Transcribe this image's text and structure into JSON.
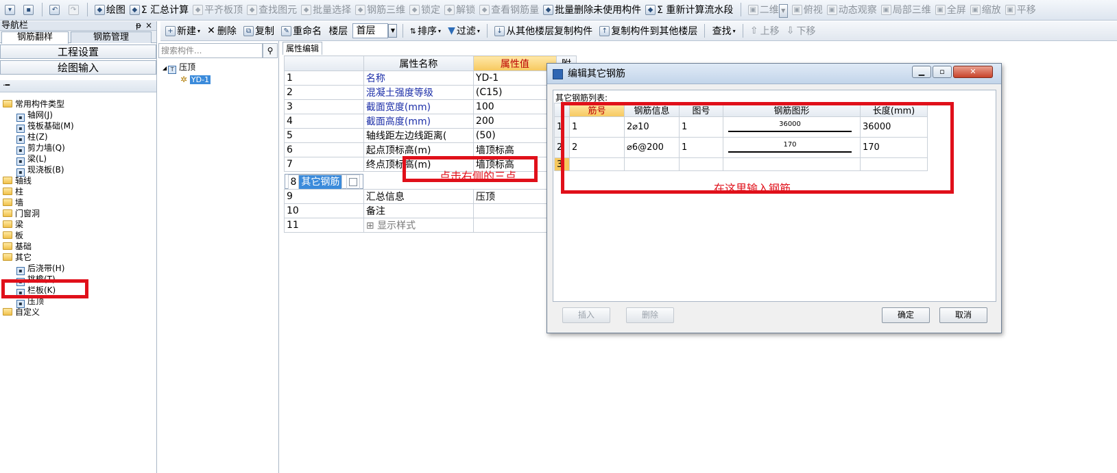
{
  "toolbar": {
    "items": [
      {
        "label": "绘图",
        "icon": "draw-icon",
        "disabled": false
      },
      {
        "label": "Σ 汇总计算",
        "icon": "sum-icon",
        "disabled": false
      },
      {
        "label": "平齐板顶",
        "icon": "align-icon",
        "disabled": true
      },
      {
        "label": "查找图元",
        "icon": "find-icon",
        "disabled": true
      },
      {
        "label": "批量选择",
        "icon": "batch-select-icon",
        "disabled": true
      },
      {
        "label": "钢筋三维",
        "icon": "rebar-3d-icon",
        "disabled": true
      },
      {
        "label": "锁定",
        "icon": "lock-icon",
        "disabled": true
      },
      {
        "label": "解锁",
        "icon": "unlock-icon",
        "disabled": true
      },
      {
        "label": "查看钢筋量",
        "icon": "view-icon",
        "disabled": true
      },
      {
        "label": "批量删除未使用构件",
        "icon": "batch-delete-icon",
        "disabled": false
      },
      {
        "label": "Σ 重新计算流水段",
        "icon": "recalc-icon",
        "disabled": false
      }
    ],
    "view_items": [
      {
        "label": "二维",
        "disabled": true
      },
      {
        "label": "俯视",
        "disabled": true
      },
      {
        "label": "动态观察",
        "disabled": true
      },
      {
        "label": "局部三维",
        "disabled": true
      },
      {
        "label": "全屏",
        "disabled": true
      },
      {
        "label": "缩放",
        "disabled": true
      },
      {
        "label": "平移",
        "disabled": true
      }
    ]
  },
  "subtoolbar": {
    "new": "新建",
    "delete": "删除",
    "copy": "复制",
    "rename": "重命名",
    "floor_label": "楼层",
    "floor_value": "首层",
    "sort": "排序",
    "filter": "过滤",
    "copy_from": "从其他楼层复制构件",
    "copy_to": "复制构件到其他楼层",
    "find": "查找",
    "move_up": "上移",
    "move_down": "下移"
  },
  "nav": {
    "title": "导航栏",
    "pin": "ᵽ",
    "close": "×",
    "tabs": [
      "钢筋翻样",
      "钢筋管理"
    ],
    "buttons": [
      "工程设置",
      "绘图输入"
    ],
    "tree": [
      {
        "label": "常用构件类型",
        "level": 0,
        "type": "folder"
      },
      {
        "label": "轴网(J)",
        "level": 1,
        "type": "item",
        "icon": "grid-icon"
      },
      {
        "label": "筏板基础(M)",
        "level": 1,
        "type": "item",
        "icon": "raft-icon"
      },
      {
        "label": "柱(Z)",
        "level": 1,
        "type": "item",
        "icon": "column-icon"
      },
      {
        "label": "剪力墙(Q)",
        "level": 1,
        "type": "item",
        "icon": "wall-icon"
      },
      {
        "label": "梁(L)",
        "level": 1,
        "type": "item",
        "icon": "beam-icon"
      },
      {
        "label": "现浇板(B)",
        "level": 1,
        "type": "item",
        "icon": "slab-icon"
      },
      {
        "label": "轴线",
        "level": 0,
        "type": "folder"
      },
      {
        "label": "柱",
        "level": 0,
        "type": "folder"
      },
      {
        "label": "墙",
        "level": 0,
        "type": "folder"
      },
      {
        "label": "门窗洞",
        "level": 0,
        "type": "folder"
      },
      {
        "label": "梁",
        "level": 0,
        "type": "folder"
      },
      {
        "label": "板",
        "level": 0,
        "type": "folder"
      },
      {
        "label": "基础",
        "level": 0,
        "type": "folder"
      },
      {
        "label": "其它",
        "level": 0,
        "type": "folder"
      },
      {
        "label": "后浇带(H)",
        "level": 1,
        "type": "item",
        "icon": "post-cast-icon"
      },
      {
        "label": "挑檐(T)",
        "level": 1,
        "type": "item",
        "icon": "eave-icon"
      },
      {
        "label": "栏板(K)",
        "level": 1,
        "type": "item",
        "icon": "parapet-icon"
      },
      {
        "label": "压顶",
        "level": 1,
        "type": "item",
        "icon": "coping-icon"
      },
      {
        "label": "自定义",
        "level": 0,
        "type": "folder"
      }
    ]
  },
  "component_list": {
    "search_placeholder": "搜索构件...",
    "root": "压顶",
    "child": "YD-1"
  },
  "properties": {
    "tab_label": "属性编辑",
    "headers": [
      "属性名称",
      "属性值",
      "附"
    ],
    "rows": [
      {
        "n": "1",
        "name": "名称",
        "value": "YD-1",
        "style": "blue",
        "check": false
      },
      {
        "n": "2",
        "name": "混凝土强度等级",
        "value": "(C15)",
        "style": "blue",
        "check": true
      },
      {
        "n": "3",
        "name": "截面宽度(mm)",
        "value": "100",
        "style": "blue",
        "check": true
      },
      {
        "n": "4",
        "name": "截面高度(mm)",
        "value": "200",
        "style": "blue",
        "check": true
      },
      {
        "n": "5",
        "name": "轴线距左边线距离(",
        "value": "(50)",
        "style": "normal",
        "check": true
      },
      {
        "n": "6",
        "name": "起点顶标高(m)",
        "value": "墙顶标高",
        "style": "normal",
        "check": true
      },
      {
        "n": "7",
        "name": "终点顶标高(m)",
        "value": "墙顶标高",
        "style": "normal",
        "check": true
      },
      {
        "n": "8",
        "name": "其它钢筋",
        "value": "",
        "style": "selected",
        "check": true
      },
      {
        "n": "9",
        "name": "汇总信息",
        "value": "压顶",
        "style": "normal",
        "check": true
      },
      {
        "n": "10",
        "name": "备注",
        "value": "",
        "style": "normal",
        "check": true
      },
      {
        "n": "11",
        "name": "显示样式",
        "value": "",
        "style": "gray",
        "check": false
      }
    ]
  },
  "annotations": {
    "click_hint": "点击右侧的三点",
    "input_hint": "在这里输入钢筋"
  },
  "dialog": {
    "title": "编辑其它钢筋",
    "list_label": "其它钢筋列表:",
    "headers": [
      "筋号",
      "钢筋信息",
      "图号",
      "钢筋图形",
      "长度(mm)"
    ],
    "rows": [
      {
        "rn": "1",
        "no": "1",
        "info": "2⌀10",
        "fig": "1",
        "shape": "36000",
        "length": "36000"
      },
      {
        "rn": "2",
        "no": "2",
        "info": "⌀6@200",
        "fig": "1",
        "shape": "170",
        "length": "170"
      },
      {
        "rn": "3",
        "no": "",
        "info": "",
        "fig": "",
        "shape": "",
        "length": ""
      }
    ],
    "buttons": {
      "insert": "插入",
      "delete": "删除",
      "ok": "确定",
      "cancel": "取消"
    }
  }
}
